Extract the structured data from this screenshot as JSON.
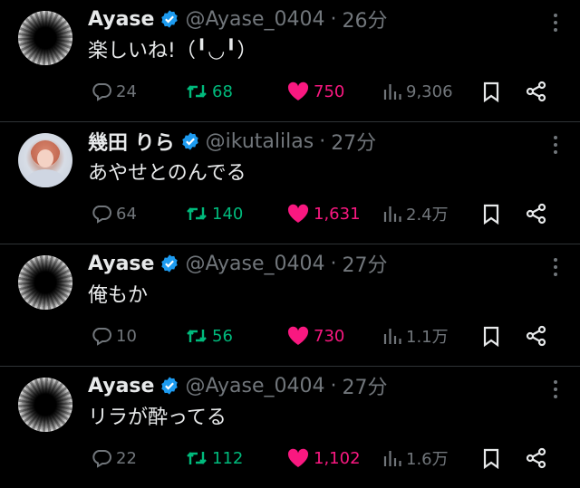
{
  "tweets": [
    {
      "avatar": "blob",
      "name": "Ayase",
      "handle": "@Ayase_0404",
      "sep": "·",
      "time": "26分",
      "text": "楽しいね!（╹◡╹）",
      "replies": "24",
      "retweets": "68",
      "likes": "750",
      "views": "9,306"
    },
    {
      "avatar": "person",
      "name": "幾田 りら",
      "handle": "@ikutalilas",
      "sep": "·",
      "time": "27分",
      "text": "あやせとのんでる",
      "replies": "64",
      "retweets": "140",
      "likes": "1,631",
      "views": "2.4万"
    },
    {
      "avatar": "blob",
      "name": "Ayase",
      "handle": "@Ayase_0404",
      "sep": "·",
      "time": "27分",
      "text": "俺もか",
      "replies": "10",
      "retweets": "56",
      "likes": "730",
      "views": "1.1万"
    },
    {
      "avatar": "blob",
      "name": "Ayase",
      "handle": "@Ayase_0404",
      "sep": "·",
      "time": "27分",
      "text": "リラが酔ってる",
      "replies": "22",
      "retweets": "112",
      "likes": "1,102",
      "views": "1.6万"
    }
  ],
  "colors": {
    "background": "#000000",
    "text": "#e7e9ea",
    "muted": "#71767b",
    "verified": "#1d9bf0",
    "retweet": "#00ba7c",
    "like": "#f91880"
  },
  "icons": {
    "verified": "verified-badge-icon",
    "more": "more-dots-icon",
    "reply": "reply-bubble-icon",
    "retweet": "retweet-arrows-icon",
    "like": "heart-filled-icon",
    "views": "views-bars-icon",
    "bookmark": "bookmark-icon",
    "share": "share-icon"
  }
}
